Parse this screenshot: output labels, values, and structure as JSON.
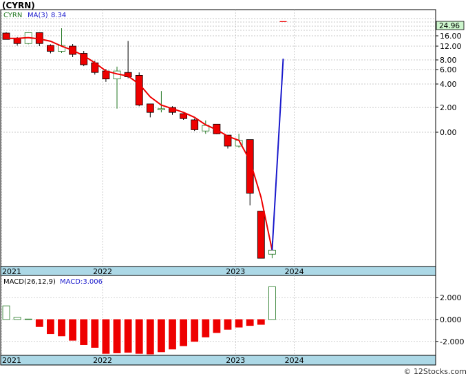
{
  "ticker_label": "(CYRN)",
  "watermark": "© 12Stocks.com",
  "colors": {
    "bear": "#ee0000",
    "bull": "#ffffff",
    "ma": "#ee0000",
    "forecast": "#1a1acc",
    "axis_band": "#acd8e6",
    "grid": "#b8b8b8",
    "price_tag_bg": "#ccf5cc",
    "legend_symbol": "#227722",
    "legend_ma": "#1a1acc"
  },
  "chart_data": [
    {
      "type": "candlestick",
      "legend": {
        "symbol": "CYRN",
        "ma_label": "MA(3)",
        "ma_value": "8.34"
      },
      "price_tag": "24.96",
      "y_tick_labels": [
        "16.00",
        "12.00",
        "8.00",
        "6.00",
        "4.00",
        "2.00",
        "0.00"
      ],
      "x_tick_labels": [
        "2021",
        "2022",
        "2023",
        "2024"
      ],
      "candles": [
        {
          "o": 18.0,
          "h": 18.6,
          "l": 14.8,
          "c": 14.6
        },
        {
          "o": 14.9,
          "h": 15.5,
          "l": 12.2,
          "c": 13.0
        },
        {
          "o": 13.0,
          "h": 18.6,
          "l": 12.7,
          "c": 18.3
        },
        {
          "o": 18.3,
          "h": 18.6,
          "l": 12.0,
          "c": 13.0
        },
        {
          "o": 12.3,
          "h": 12.7,
          "l": 9.9,
          "c": 10.5
        },
        {
          "o": 10.5,
          "h": 22.0,
          "l": 10.0,
          "c": 12.3
        },
        {
          "o": 12.0,
          "h": 12.8,
          "l": 8.8,
          "c": 9.6
        },
        {
          "o": 9.9,
          "h": 10.6,
          "l": 6.7,
          "c": 7.0
        },
        {
          "o": 7.4,
          "h": 7.8,
          "l": 5.3,
          "c": 5.6
        },
        {
          "o": 5.8,
          "h": 6.1,
          "l": 4.3,
          "c": 4.7
        },
        {
          "o": 4.7,
          "h": 6.6,
          "l": 1.9,
          "c": 5.8
        },
        {
          "o": 5.6,
          "h": 14.0,
          "l": 4.8,
          "c": 5.0
        },
        {
          "o": 5.2,
          "h": 5.6,
          "l": 2.1,
          "c": 2.2
        },
        {
          "o": 2.3,
          "h": 2.3,
          "l": 1.2,
          "c": 1.6
        },
        {
          "o": 1.8,
          "h": 3.4,
          "l": 1.6,
          "c": 1.9
        },
        {
          "o": 2.0,
          "h": 2.1,
          "l": 1.4,
          "c": 1.6
        },
        {
          "o": 1.5,
          "h": 1.5,
          "l": 1.0,
          "c": 1.1
        },
        {
          "o": 1.0,
          "h": 1.1,
          "l": 0.1,
          "c": 0.2
        },
        {
          "o": 0.1,
          "h": 0.95,
          "l": -0.2,
          "c": 0.55
        },
        {
          "o": 0.65,
          "h": 0.65,
          "l": -0.25,
          "c": -0.2
        },
        {
          "o": -0.35,
          "h": -0.35,
          "l": -2.0,
          "c": -1.7
        },
        {
          "o": -1.7,
          "h": -0.2,
          "l": -1.9,
          "c": -1.0
        },
        {
          "o": -0.9,
          "h": -0.9,
          "l": -9.0,
          "c": -7.5
        },
        {
          "o": -9.7,
          "h": -9.7,
          "l": -15.5,
          "c": -15.5
        },
        {
          "o": -15.0,
          "h": -13.4,
          "l": -15.5,
          "c": -14.5
        }
      ],
      "last_candle": {
        "o": -14.3,
        "h": 28.7,
        "l": -14.9,
        "c": 28.5
      },
      "ma_line": [
        15.0,
        15.0,
        15.3,
        14.8,
        13.9,
        12.0,
        10.8,
        9.2,
        7.4,
        5.8,
        5.4,
        5.1,
        4.0,
        2.9,
        2.2,
        1.9,
        1.6,
        1.2,
        0.6,
        0.2,
        -0.5,
        -1.0,
        -3.5,
        -8.0,
        -14.5
      ],
      "ma_forecast": [
        -14.5,
        8.34
      ]
    },
    {
      "type": "bar",
      "legend": {
        "label": "MACD(26,12,9)",
        "value_label": "MACD:3.006"
      },
      "y_tick_labels": [
        "2.000",
        "0.000",
        "-2.000"
      ],
      "x_tick_labels": [
        "2021",
        "2022",
        "2023",
        "2024"
      ],
      "values": [
        1.25,
        0.2,
        0.05,
        -0.65,
        -1.3,
        -1.5,
        -1.9,
        -2.3,
        -2.55,
        -3.1,
        -3.05,
        -3.0,
        -3.1,
        -3.15,
        -2.95,
        -2.7,
        -2.4,
        -2.0,
        -1.6,
        -1.2,
        -0.9,
        -0.7,
        -0.55,
        -0.45,
        3.0
      ]
    }
  ]
}
